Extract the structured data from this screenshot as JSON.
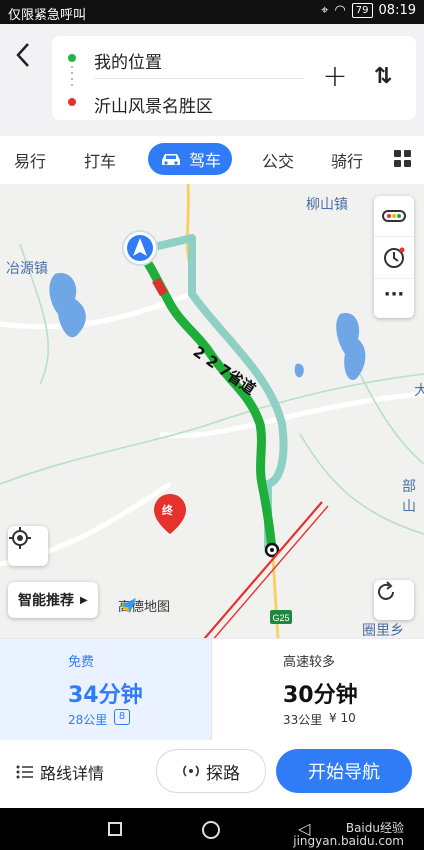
{
  "status_bar": {
    "carrier": "仅限紧急呼叫",
    "battery": "79",
    "time": "08:19"
  },
  "header": {
    "start": "我的位置",
    "end": "沂山风景名胜区",
    "add_label": "+",
    "swap_label": "⇅"
  },
  "modes": [
    {
      "label": "易行"
    },
    {
      "label": "打车"
    },
    {
      "label": "驾车",
      "active": true
    },
    {
      "label": "公交"
    },
    {
      "label": "骑行"
    }
  ],
  "map": {
    "labels": {
      "liushan": "柳山镇",
      "yeyuan": "冶源镇",
      "gao": "部山",
      "gaoyuan": "圈里乡",
      "da": "大",
      "dest_marker": "终",
      "road_name": "2 2 7省道",
      "highway": "G25"
    },
    "smart_label": "智能推荐",
    "logo_text": "高德地图",
    "route_color": "#1fae3a",
    "alt_route_color": "#8fd0c4"
  },
  "routes": [
    {
      "tag": "免费",
      "time": "34分钟",
      "distance": "28公里",
      "lights": "8"
    },
    {
      "tag": "高速较多",
      "time": "30分钟",
      "distance": "33公里",
      "toll": "¥ 10"
    }
  ],
  "actions": {
    "detail": "路线详情",
    "explore": "探路",
    "start_nav": "开始导航"
  },
  "watermark": {
    "line1": "Baidu经验",
    "line2": "jingyan.baidu.com"
  }
}
